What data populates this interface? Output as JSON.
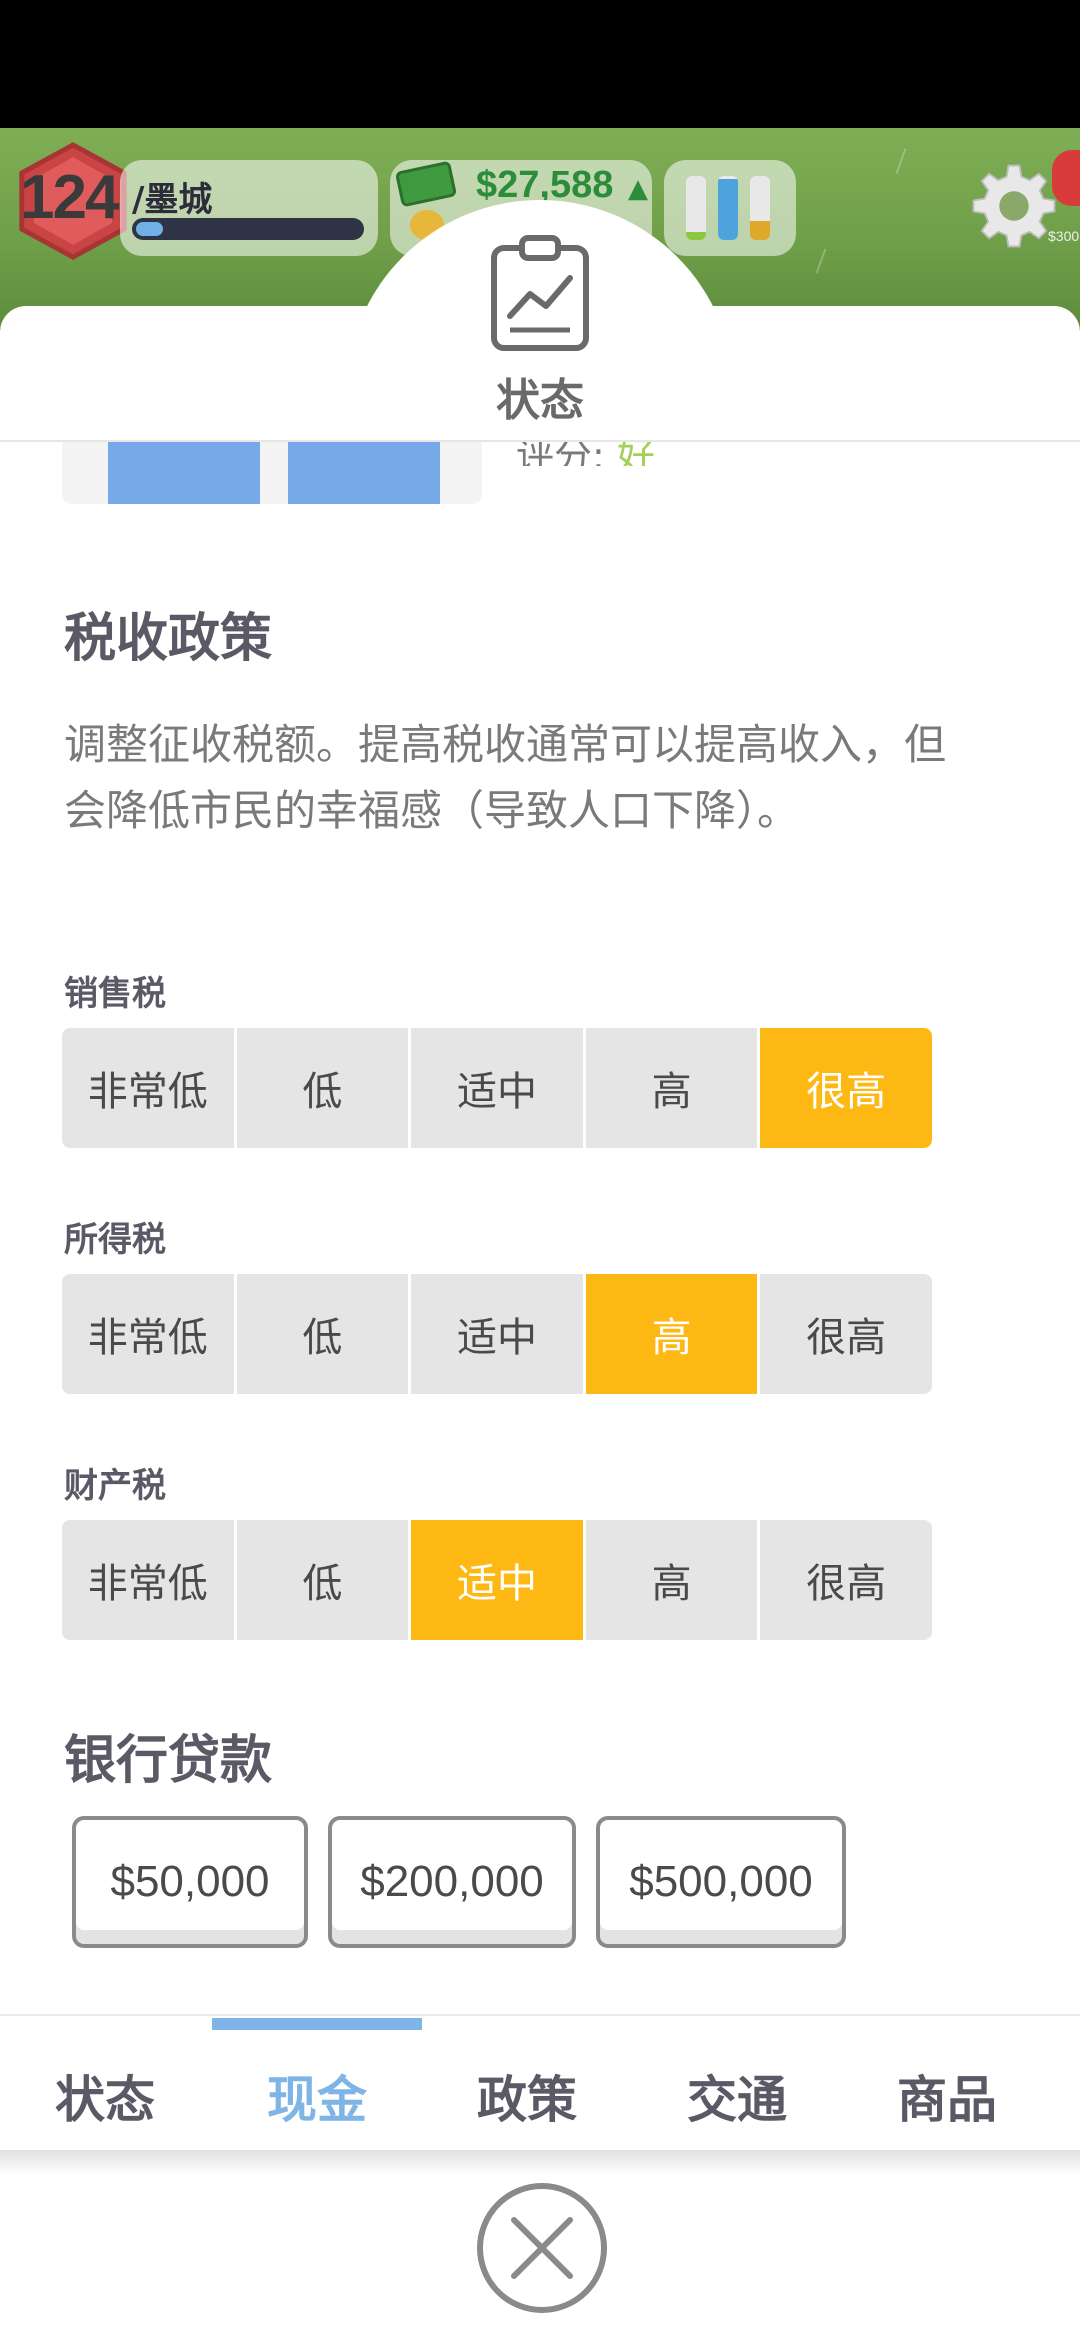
{
  "hud": {
    "level": "124",
    "city_name": "/墨城",
    "city_progress": 0.12,
    "money": "$27,588",
    "money_trend_icon": "up-arrow",
    "notif_amount": "$300",
    "stats": [
      {
        "color": "#8dc63f",
        "level": 0.12
      },
      {
        "color": "#4fa3dd",
        "level": 0.95
      },
      {
        "color": "#e0a829",
        "level": 0.3
      }
    ]
  },
  "panel": {
    "header_icon": "clipboard-chart-icon",
    "title": "状态",
    "partial_rating_label": "评分: ",
    "partial_rating_value": "好"
  },
  "tax": {
    "title": "税收政策",
    "description": "调整征收税额。提高税收通常可以提高收入，但会降低市民的幸福感（导致人口下降）。",
    "options": [
      "非常低",
      "低",
      "适中",
      "高",
      "很高"
    ],
    "groups": [
      {
        "label": "销售税",
        "selected": 4
      },
      {
        "label": "所得税",
        "selected": 3
      },
      {
        "label": "财产税",
        "selected": 2
      }
    ]
  },
  "loan": {
    "title": "银行贷款",
    "amounts": [
      "$50,000",
      "$200,000",
      "$500,000"
    ]
  },
  "tabs": {
    "items": [
      "状态",
      "现金",
      "政策",
      "交通",
      "商品"
    ],
    "active": 1
  },
  "colors": {
    "selected": "#fdb813",
    "active_tab": "#7fb5e6"
  }
}
